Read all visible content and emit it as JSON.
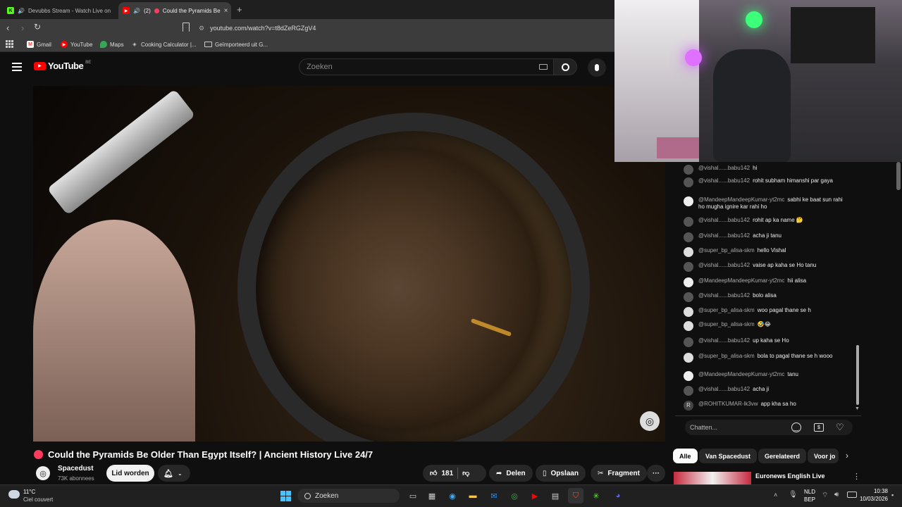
{
  "browser": {
    "tabs": [
      {
        "title": "Devubbs Stream - Watch Live on",
        "active": false
      },
      {
        "counter": "(2)",
        "title": "Could the Pyramids Be",
        "active": true
      }
    ],
    "new_tab": "+",
    "url": "youtube.com/watch?v=t8dZeRGZgV4",
    "bookmarks": [
      "Gmail",
      "YouTube",
      "Maps",
      "Cooking Calculator |...",
      "Geïmporteerd uit G..."
    ]
  },
  "youtube": {
    "logo": "YouTube",
    "region": "BE",
    "search_placeholder": "Zoeken",
    "video_title": "Could the Pyramids Be Older Than Egypt Itself? | Ancient History Live 24/7",
    "channel_name": "Spacedust",
    "subscribers": "73K abonnees",
    "member_button": "Lid worden",
    "likes": "181",
    "share": "Delen",
    "save": "Opslaan",
    "clip": "Fragment",
    "more": "···"
  },
  "chat": {
    "input_placeholder": "Chatten...",
    "messages": [
      {
        "author": "@vishal......babu142",
        "text": "hi"
      },
      {
        "author": "@vishal......babu142",
        "text": "rohit subham himanshi par gaya"
      },
      {
        "author": "@MandeepMandeepKumar-yt2mc",
        "text": "sabhi ke baat sun rahi ho mugha ignire kar rahi ho"
      },
      {
        "author": "@vishal......babu142",
        "text": "rohit ap ka name 🤔"
      },
      {
        "author": "@vishal......babu142",
        "text": "acha ji tanu"
      },
      {
        "author": "@super_bp_alisa-skm",
        "text": "hello Vishal"
      },
      {
        "author": "@vishal......babu142",
        "text": "vaise ap kaha se Ho tanu"
      },
      {
        "author": "@MandeepMandeepKumar-yt2mc",
        "text": "hii alisa"
      },
      {
        "author": "@vishal......babu142",
        "text": "bolo alisa"
      },
      {
        "author": "@super_bp_alisa-skm",
        "text": "woo pagal thane se h"
      },
      {
        "author": "@super_bp_alisa-skm",
        "text": "🤣😂"
      },
      {
        "author": "@vishal......babu142",
        "text": "up kaha se Ho"
      },
      {
        "author": "@super_bp_alisa-skm",
        "text": "bola to pagal thane se h wooo"
      },
      {
        "author": "@MandeepMandeepKumar-yt2mc",
        "text": "tanu"
      },
      {
        "author": "@vishal......babu142",
        "text": "acha ji"
      },
      {
        "author": "@ROHITKUMAR-lk3vw",
        "text": "app kha sa ho"
      }
    ],
    "rohit_avatar_letter": "R"
  },
  "chips": [
    "Alle",
    "Van Spacedust",
    "Gerelateerd",
    "Voor jo"
  ],
  "recommendation": {
    "title": "Euronews English Live"
  },
  "taskbar": {
    "weather_temp": "11°C",
    "weather_desc": "Ciel couvert",
    "search_label": "Zoeken",
    "lang_top": "NLD",
    "lang_bottom": "BEP",
    "time": "10:38",
    "date": "10/03/2026"
  },
  "colors": {
    "youtube_red": "#ff0000",
    "live_dot": "#ff3b5c",
    "taskbar": "#202020"
  }
}
